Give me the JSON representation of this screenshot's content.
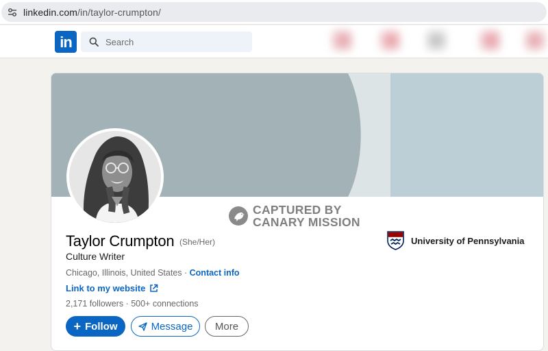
{
  "browser": {
    "url_host": "linkedin.com",
    "url_path": "/in/taylor-crumpton/",
    "site_info_icon": "tune-icon"
  },
  "nav": {
    "logo_text": "in",
    "search_placeholder": "Search",
    "brand_color": "#0a66c2"
  },
  "profile": {
    "name": "Taylor Crumpton",
    "pronouns": "(She/Her)",
    "headline": "Culture Writer",
    "location": "Chicago, Illinois, United States",
    "location_separator": " · ",
    "contact_link": "Contact info",
    "website_link": "Link to my website",
    "followers": "2,171 followers",
    "stats_separator": " · ",
    "connections": "500+ connections",
    "education": "University of Pennsylvania"
  },
  "watermark": {
    "line1": "CAPTURED BY",
    "line2": "CANARY MISSION"
  },
  "actions": {
    "follow_icon": "+",
    "follow_label": "Follow",
    "message_label": "Message",
    "more_label": "More"
  }
}
